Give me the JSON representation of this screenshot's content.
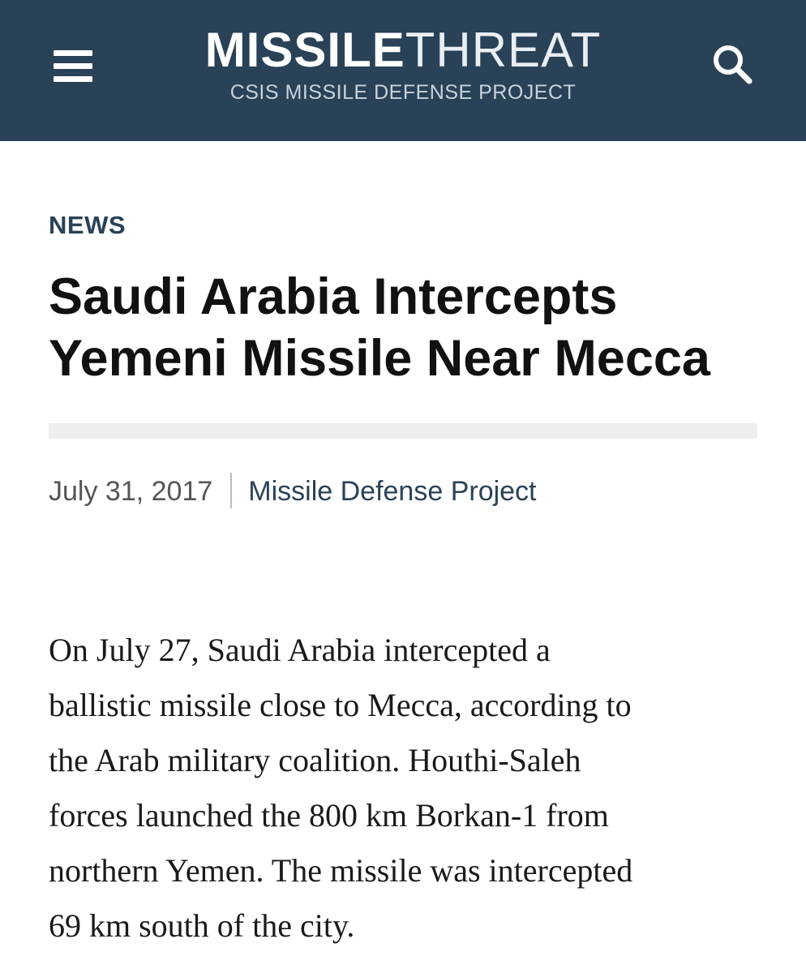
{
  "header": {
    "logo_bold": "MISSILE",
    "logo_light": "THREAT",
    "logo_sub": "CSIS MISSILE DEFENSE PROJECT",
    "menu_icon": "hamburger-menu-icon",
    "search_icon": "search-icon",
    "background_color": "#2a4257"
  },
  "article": {
    "section": "NEWS",
    "title_lines": [
      "Saudi Arabia Intercepts",
      "Yemeni Missile Near Mecca"
    ],
    "date": "July 31, 2017",
    "author": "Missile Defense Project",
    "body_lines": [
      "On July 27, Saudi Arabia intercepted a",
      "ballistic missile close to Mecca, according to",
      "the Arab military coalition. Houthi-Saleh",
      "forces launched the 800 km Borkan-1 from",
      "northern Yemen. The missile was intercepted",
      "69 km south of the city."
    ]
  }
}
